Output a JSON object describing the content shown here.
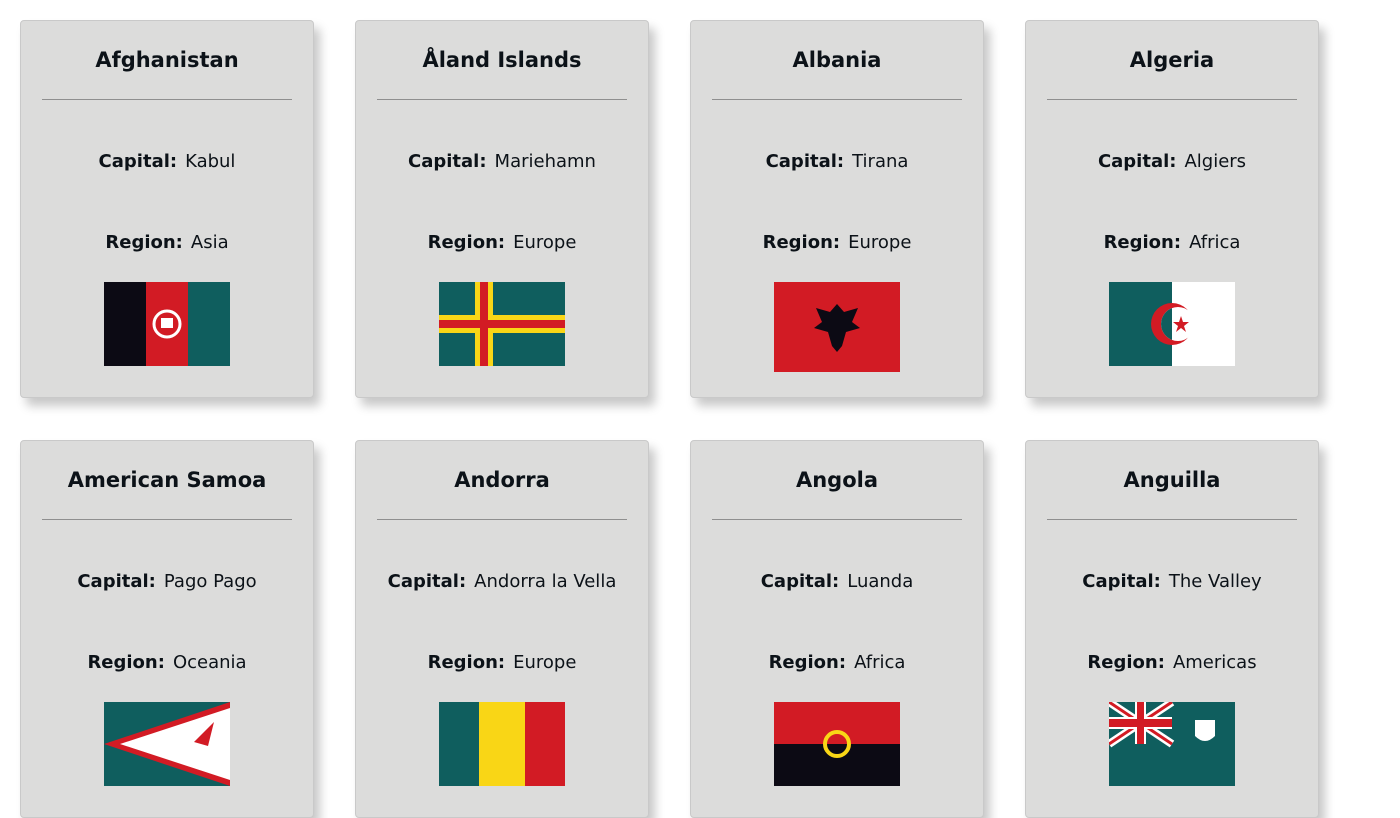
{
  "labels": {
    "capital": "Capital:",
    "region": "Region:"
  },
  "countries": [
    {
      "name": "Afghanistan",
      "capital": "Kabul",
      "region": "Asia",
      "flag": "afghanistan-flag"
    },
    {
      "name": "Åland Islands",
      "capital": "Mariehamn",
      "region": "Europe",
      "flag": "aland-flag"
    },
    {
      "name": "Albania",
      "capital": "Tirana",
      "region": "Europe",
      "flag": "albania-flag"
    },
    {
      "name": "Algeria",
      "capital": "Algiers",
      "region": "Africa",
      "flag": "algeria-flag"
    },
    {
      "name": "American Samoa",
      "capital": "Pago Pago",
      "region": "Oceania",
      "flag": "american-samoa-flag"
    },
    {
      "name": "Andorra",
      "capital": "Andorra la Vella",
      "region": "Europe",
      "flag": "andorra-flag"
    },
    {
      "name": "Angola",
      "capital": "Luanda",
      "region": "Africa",
      "flag": "angola-flag"
    },
    {
      "name": "Anguilla",
      "capital": "The Valley",
      "region": "Americas",
      "flag": "anguilla-flag"
    }
  ],
  "colors": {
    "teal": "#0f5e5e",
    "red": "#d21b24",
    "yellow": "#f9d616",
    "black": "#0c0a14",
    "card": "#dcdcdb"
  }
}
